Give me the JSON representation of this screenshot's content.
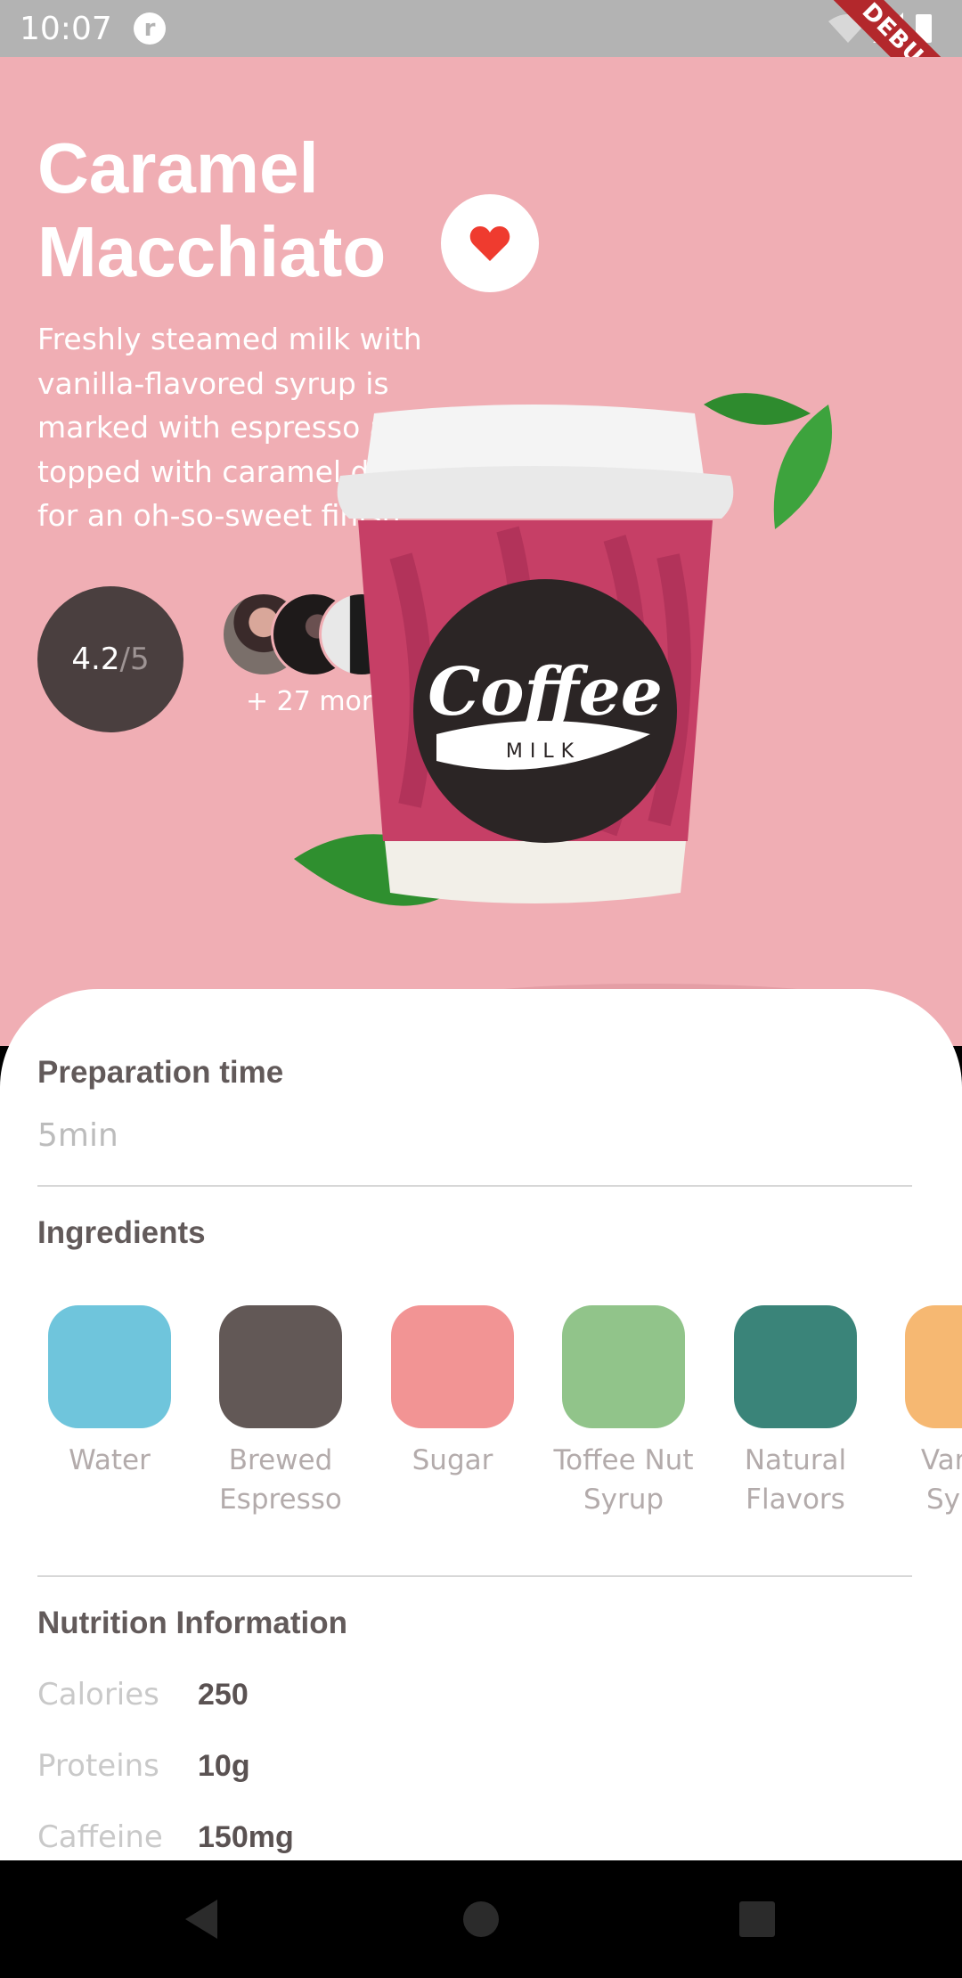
{
  "status_bar": {
    "time": "10:07",
    "debug_label": "DEBUG"
  },
  "product": {
    "title": "Caramel Macchiato",
    "description": "Freshly steamed milk with vanilla-flavored syrup is marked with espresso and topped with caramel drizzle for an oh-so-sweet finish.",
    "rating": {
      "value": "4.2",
      "max": "/5"
    },
    "reviewers_more": "+ 27 more",
    "cup_logo_text": "Coffee",
    "cup_logo_subtext": "MILK"
  },
  "details": {
    "prep_title": "Preparation time",
    "prep_value": "5min",
    "ingredients_title": "Ingredients",
    "ingredients": [
      {
        "name_line1": "Water",
        "name_line2": "",
        "color": "#6fc5dc"
      },
      {
        "name_line1": "Brewed",
        "name_line2": "Espresso",
        "color": "#625856"
      },
      {
        "name_line1": "Sugar",
        "name_line2": "",
        "color": "#f29494"
      },
      {
        "name_line1": "Toffee Nut",
        "name_line2": "Syrup",
        "color": "#91c48a"
      },
      {
        "name_line1": "Natural",
        "name_line2": "Flavors",
        "color": "#3a8479"
      },
      {
        "name_line1": "Vanilla",
        "name_line2": "Syrup",
        "color": "#f6b872"
      }
    ],
    "nutrition_title": "Nutrition Information",
    "nutrition": [
      {
        "label": "Calories",
        "value": "250"
      },
      {
        "label": "Proteins",
        "value": "10g"
      },
      {
        "label": "Caffeine",
        "value": "150mg"
      }
    ]
  },
  "colors": {
    "hero_bg": "#f0aeb4",
    "heart": "#ef3b2f",
    "rating_bg": "#4a3f3f",
    "cup": "#c63f66"
  }
}
